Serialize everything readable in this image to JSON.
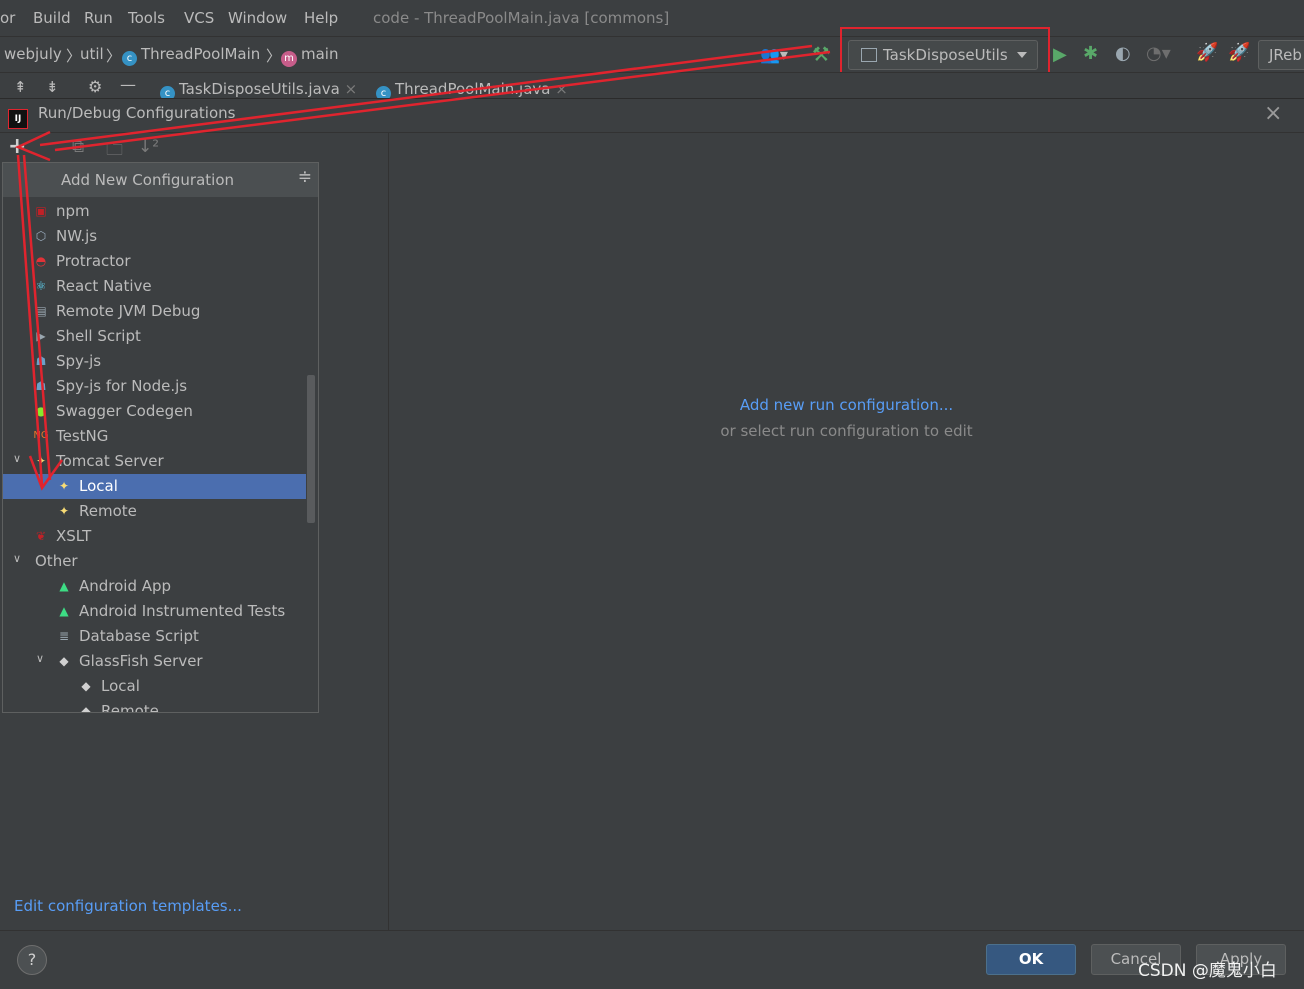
{
  "menubar": {
    "items": [
      "or",
      "Build",
      "Run",
      "Tools",
      "VCS",
      "Window",
      "Help"
    ],
    "window_title": "code - ThreadPoolMain.java [commons]"
  },
  "navbar": {
    "breadcrumb": [
      "webjuly",
      "util",
      "ThreadPoolMain",
      "main"
    ],
    "run_config": "TaskDisposeUtils",
    "jrebel_label": "JReb"
  },
  "tabs": [
    "TaskDisposeUtils.java",
    "ThreadPoolMain.java"
  ],
  "dialog": {
    "title": "Run/Debug Configurations",
    "popup_title": "Add New Configuration",
    "items": [
      {
        "label": "npm",
        "icon": "npm-icon",
        "indent": 1
      },
      {
        "label": "NW.js",
        "icon": "nwjs-icon",
        "indent": 1
      },
      {
        "label": "Protractor",
        "icon": "protractor-icon",
        "indent": 1
      },
      {
        "label": "React Native",
        "icon": "react-icon",
        "indent": 1
      },
      {
        "label": "Remote JVM Debug",
        "icon": "remote-debug-icon",
        "indent": 1
      },
      {
        "label": "Shell Script",
        "icon": "shell-icon",
        "indent": 1
      },
      {
        "label": "Spy-js",
        "icon": "spyjs-icon",
        "indent": 1
      },
      {
        "label": "Spy-js for Node.js",
        "icon": "spyjs-node-icon",
        "indent": 1
      },
      {
        "label": "Swagger Codegen",
        "icon": "swagger-icon",
        "indent": 1
      },
      {
        "label": "TestNG",
        "icon": "testng-icon",
        "indent": 1
      },
      {
        "label": "Tomcat Server",
        "icon": "tomcat-icon",
        "indent": 1,
        "expanded": true
      },
      {
        "label": "Local",
        "icon": "tomcat-icon",
        "indent": 2,
        "selected": true
      },
      {
        "label": "Remote",
        "icon": "tomcat-icon",
        "indent": 2
      },
      {
        "label": "XSLT",
        "icon": "xslt-icon",
        "indent": 1
      },
      {
        "label": "Other",
        "icon": "",
        "indent": 0,
        "expanded": true
      },
      {
        "label": "Android App",
        "icon": "android-icon",
        "indent": 2
      },
      {
        "label": "Android Instrumented Tests",
        "icon": "android-test-icon",
        "indent": 2
      },
      {
        "label": "Database Script",
        "icon": "database-icon",
        "indent": 2
      },
      {
        "label": "GlassFish Server",
        "icon": "glassfish-icon",
        "indent": 2,
        "expanded": true
      },
      {
        "label": "Local",
        "icon": "glassfish-icon",
        "indent": 3
      },
      {
        "label": "Remote",
        "icon": "glassfish-icon",
        "indent": 3
      }
    ],
    "hint_link": "Add new run configuration...",
    "hint_text": "or select run configuration to edit",
    "templates_link": "Edit configuration templates...",
    "buttons": {
      "ok": "OK",
      "cancel": "Cancel",
      "apply": "Apply"
    },
    "help": "?"
  },
  "watermark": "CSDN @魔鬼小白",
  "colors": {
    "annotation": "#e0242e",
    "selection": "#4b6eaf",
    "link": "#589df6"
  }
}
